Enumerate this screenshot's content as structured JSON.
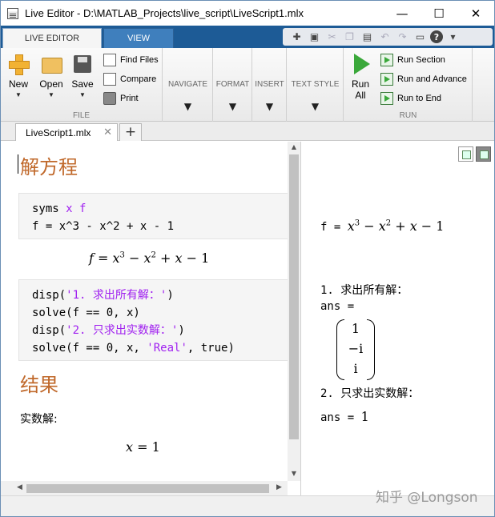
{
  "window": {
    "title": "Live Editor - D:\\MATLAB_Projects\\live_script\\LiveScript1.mlx",
    "minimize": "—",
    "maximize": "☐",
    "close": "✕"
  },
  "ribbon_tabs": {
    "live_editor": "LIVE EDITOR",
    "view": "VIEW"
  },
  "quick_access": {
    "icons": [
      "new-icon",
      "save-icon",
      "cut-icon",
      "copy-icon",
      "paste-icon",
      "undo-icon",
      "redo-icon",
      "switch-windows-icon",
      "help-icon",
      "expand-icon"
    ]
  },
  "ribbon": {
    "file": {
      "new": "New",
      "open": "Open",
      "save": "Save",
      "find_files": "Find Files",
      "compare": "Compare",
      "print": "Print",
      "label": "FILE"
    },
    "navigate": "NAVIGATE",
    "format": "FORMAT",
    "insert": "INSERT",
    "text_style": "TEXT STYLE",
    "run": {
      "run_all_1": "Run",
      "run_all_2": "All",
      "run_section": "Run Section",
      "run_and_advance": "Run and Advance",
      "run_to_end": "Run to End",
      "label": "RUN"
    }
  },
  "doc_tab": {
    "name": "LiveScript1.mlx",
    "close": "✕",
    "add": "+"
  },
  "editor": {
    "heading1": "解方程",
    "code1": {
      "line1_a": "syms ",
      "line1_b": "x f",
      "line2": "f = x^3 - x^2 + x - 1"
    },
    "eq1": {
      "lhs": "f",
      "rhs_a": "x",
      "sup_a": "3",
      "minus1": " − ",
      "rhs_b": "x",
      "sup_b": "2",
      "plus": " + ",
      "rhs_c": "x",
      "minus2": " − 1"
    },
    "code2": {
      "l1_a": "disp(",
      "l1_b": "'1. 求出所有解：'",
      "l1_c": ")",
      "l2": "solve(f == 0, x)",
      "l3_a": "disp(",
      "l3_b": "'2. 只求出实数解：'",
      "l3_c": ")",
      "l4_a": "solve(f == 0, x, ",
      "l4_b": "'Real'",
      "l4_c": ", true)"
    },
    "heading2": "结果",
    "text1": "实数解:",
    "eq2_lhs": "x",
    "eq2_rhs": " = 1"
  },
  "output": {
    "eq_prefix": "f = ",
    "eq_x1": "x",
    "eq_s1": "3",
    "eq_m1": " − ",
    "eq_x2": "x",
    "eq_s2": "2",
    "eq_p": " + ",
    "eq_x3": "x",
    "eq_m2": " − 1",
    "line1": "1. 求出所有解：",
    "ans1": "ans =",
    "matrix": [
      "1",
      "−i",
      "i"
    ],
    "line2": "2. 只求出实数解：",
    "ans2_prefix": "ans = ",
    "ans2_val": "1"
  },
  "watermark": "知乎 @Longson",
  "colors": {
    "heading": "#c0682a",
    "keyword": "#a020f0",
    "ribbon_blue": "#1d5b96"
  }
}
